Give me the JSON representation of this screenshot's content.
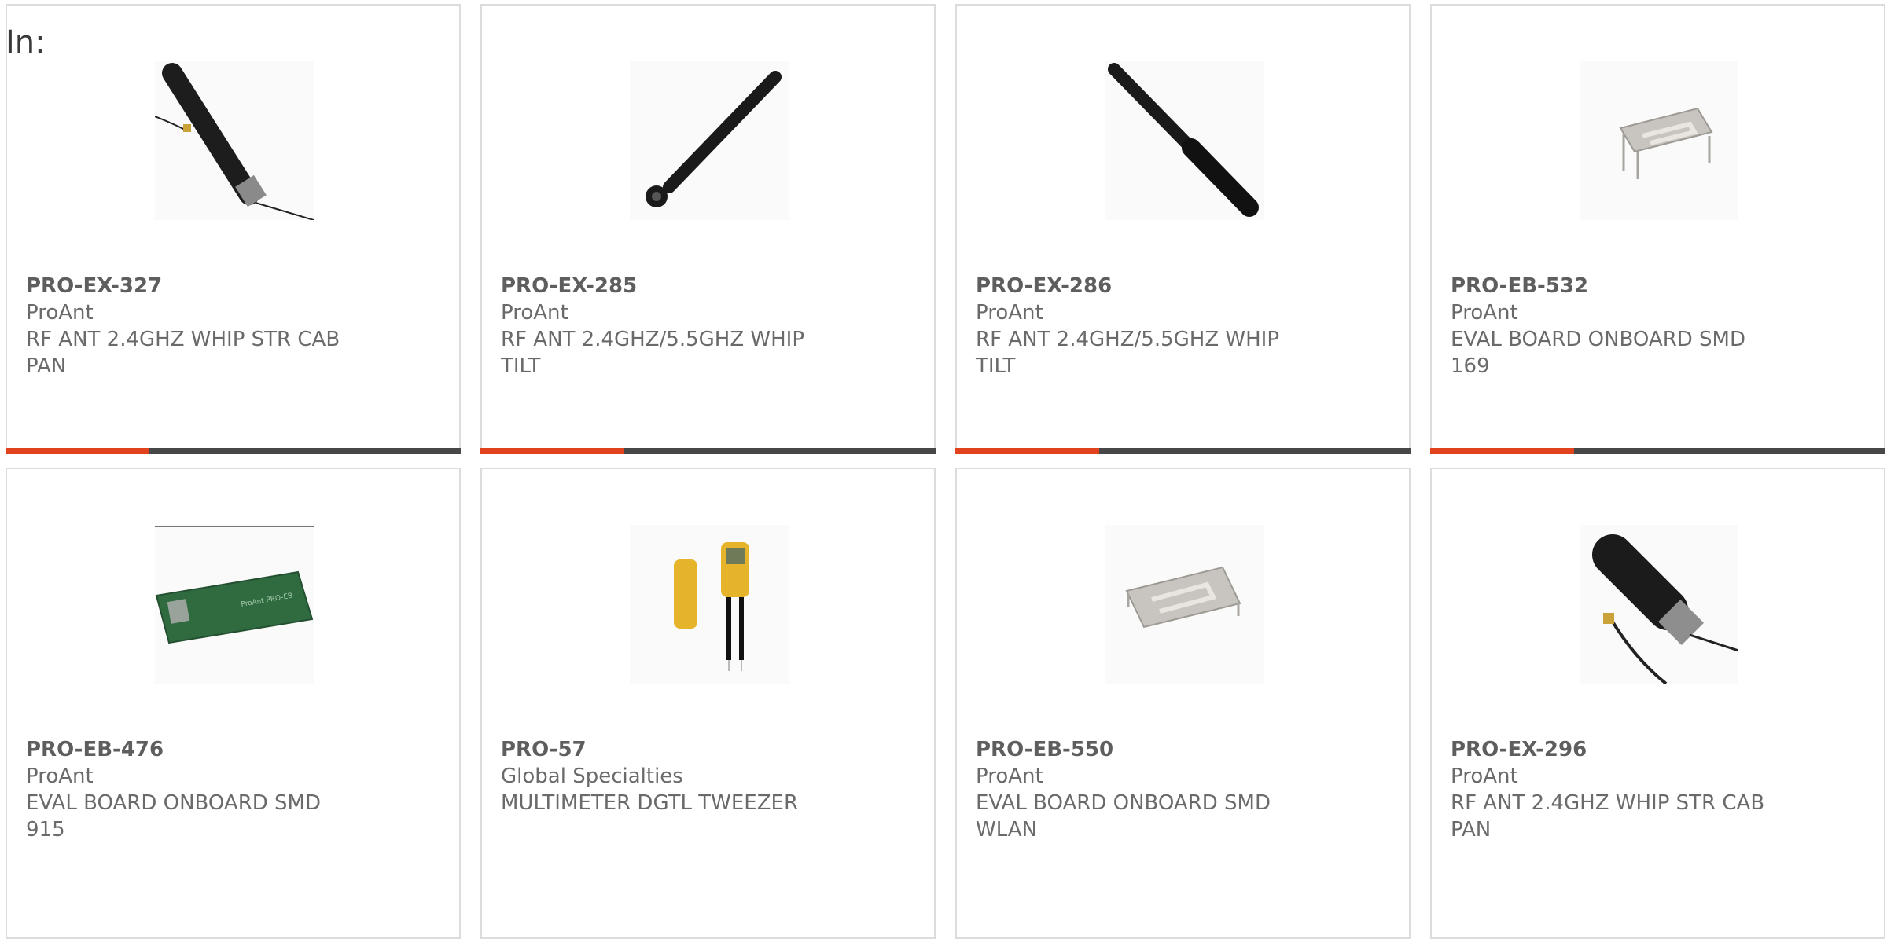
{
  "filter_label": "In:",
  "colors": {
    "accent": "#e2431f",
    "bar": "#474747",
    "border": "#dcdcdc",
    "text": "#6a6a6a"
  },
  "products": [
    {
      "part": "PRO-EX-327",
      "manufacturer": "ProAnt",
      "desc_line1": "RF ANT 2.4GHZ WHIP STR CAB",
      "desc_line2": "PAN",
      "image_icon": "whip-antenna-cable"
    },
    {
      "part": "PRO-EX-285",
      "manufacturer": "ProAnt",
      "desc_line1": "RF ANT 2.4GHZ/5.5GHZ WHIP",
      "desc_line2": "TILT",
      "image_icon": "tilt-antenna"
    },
    {
      "part": "PRO-EX-286",
      "manufacturer": "ProAnt",
      "desc_line1": "RF ANT 2.4GHZ/5.5GHZ WHIP",
      "desc_line2": "TILT",
      "image_icon": "whip-antenna"
    },
    {
      "part": "PRO-EB-532",
      "manufacturer": "ProAnt",
      "desc_line1": "EVAL BOARD ONBOARD SMD 169",
      "desc_line2": "",
      "image_icon": "smd-antenna"
    },
    {
      "part": "PRO-EB-476",
      "manufacturer": "ProAnt",
      "desc_line1": "EVAL BOARD ONBOARD SMD 915",
      "desc_line2": "",
      "image_icon": "green-pcb"
    },
    {
      "part": "PRO-57",
      "manufacturer": "Global Specialties",
      "desc_line1": "MULTIMETER DGTL TWEEZER",
      "desc_line2": "",
      "image_icon": "tweezer-multimeter"
    },
    {
      "part": "PRO-EB-550",
      "manufacturer": "ProAnt",
      "desc_line1": "EVAL BOARD ONBOARD SMD",
      "desc_line2": "WLAN",
      "image_icon": "smd-antenna"
    },
    {
      "part": "PRO-EX-296",
      "manufacturer": "ProAnt",
      "desc_line1": "RF ANT 2.4GHZ WHIP STR CAB",
      "desc_line2": "PAN",
      "image_icon": "stubby-antenna-cable"
    }
  ]
}
